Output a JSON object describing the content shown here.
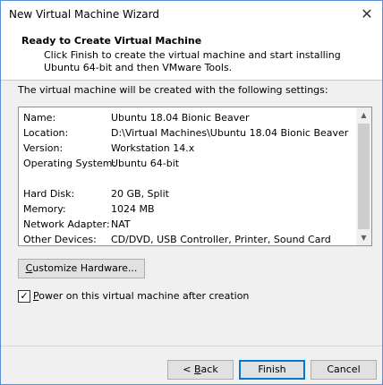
{
  "window": {
    "title": "New Virtual Machine Wizard"
  },
  "header": {
    "title": "Ready to Create Virtual Machine",
    "description": "Click Finish to create the virtual machine and start installing Ubuntu 64-bit and then VMware Tools."
  },
  "intro": "The virtual machine will be created with the following settings:",
  "settings": [
    {
      "key": "Name:",
      "value": "Ubuntu 18.04 Bionic Beaver"
    },
    {
      "key": "Location:",
      "value": "D:\\Virtual Machines\\Ubuntu 18.04 Bionic Beaver"
    },
    {
      "key": "Version:",
      "value": "Workstation 14.x"
    },
    {
      "key": "Operating System:",
      "value": "Ubuntu 64-bit"
    },
    {
      "key": "",
      "value": ""
    },
    {
      "key": "Hard Disk:",
      "value": "20 GB, Split"
    },
    {
      "key": "Memory:",
      "value": "1024 MB"
    },
    {
      "key": "Network Adapter:",
      "value": "NAT"
    },
    {
      "key": "Other Devices:",
      "value": "CD/DVD, USB Controller, Printer, Sound Card"
    }
  ],
  "buttons": {
    "customize": {
      "mnemonic": "C",
      "rest": "ustomize Hardware..."
    },
    "back": {
      "prefix": "< ",
      "mnemonic": "B",
      "rest": "ack"
    },
    "finish": "Finish",
    "cancel": "Cancel"
  },
  "power_checkbox": {
    "checked": true,
    "mnemonic": "P",
    "rest": "ower on this virtual machine after creation"
  },
  "icons": {
    "close": "close-icon",
    "scroll_up": "scroll-up-icon",
    "scroll_down": "scroll-down-icon",
    "check": "checkmark-icon"
  }
}
